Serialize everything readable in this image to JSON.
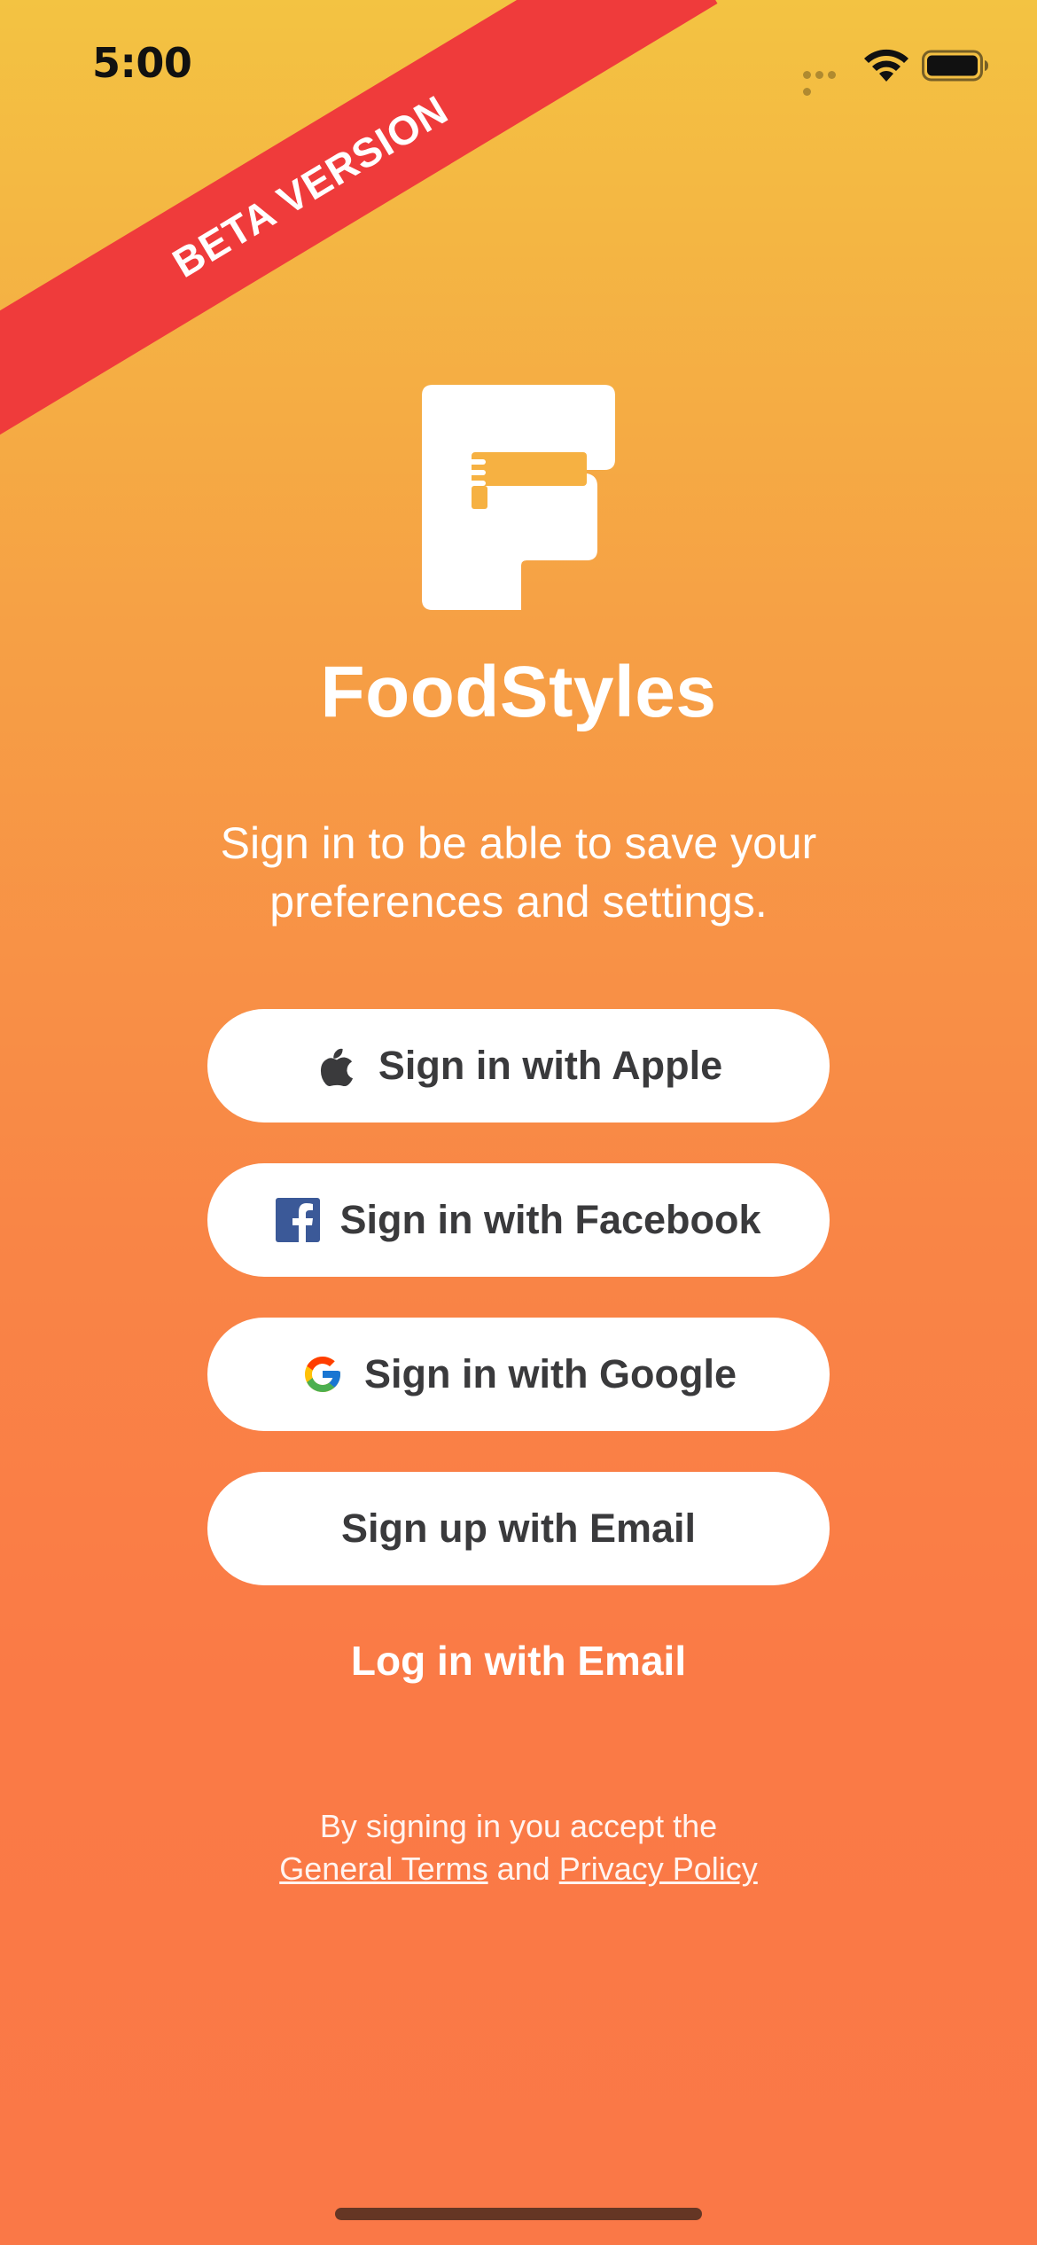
{
  "status_bar": {
    "time": "5:00",
    "icons": [
      "signal-icon",
      "wifi-icon",
      "battery-icon"
    ]
  },
  "ribbon": {
    "label": "BETA VERSION",
    "color": "#ef3b3b"
  },
  "app": {
    "name": "FoodStyles",
    "logo_icon": "foodstyles-logo-icon",
    "subtitle_line1": "Sign in to be able to save your",
    "subtitle_line2": "preferences and settings."
  },
  "buttons": {
    "apple": {
      "label": "Sign in with Apple",
      "icon": "apple-icon"
    },
    "facebook": {
      "label": "Sign in with Facebook",
      "icon": "facebook-icon"
    },
    "google": {
      "label": "Sign in with Google",
      "icon": "google-icon"
    },
    "email_signup": {
      "label": "Sign up with Email"
    }
  },
  "login_email": {
    "label": "Log in with Email"
  },
  "legal": {
    "line1": "By signing in you accept the",
    "terms_link": "General Terms",
    "conjunction": "and",
    "privacy_link": "Privacy Policy"
  },
  "colors": {
    "gradient_top": "#f3c342",
    "gradient_bottom": "#fa7847",
    "button_background": "#ffffff",
    "button_text": "#3a3a3c",
    "facebook_blue": "#3b5998"
  }
}
